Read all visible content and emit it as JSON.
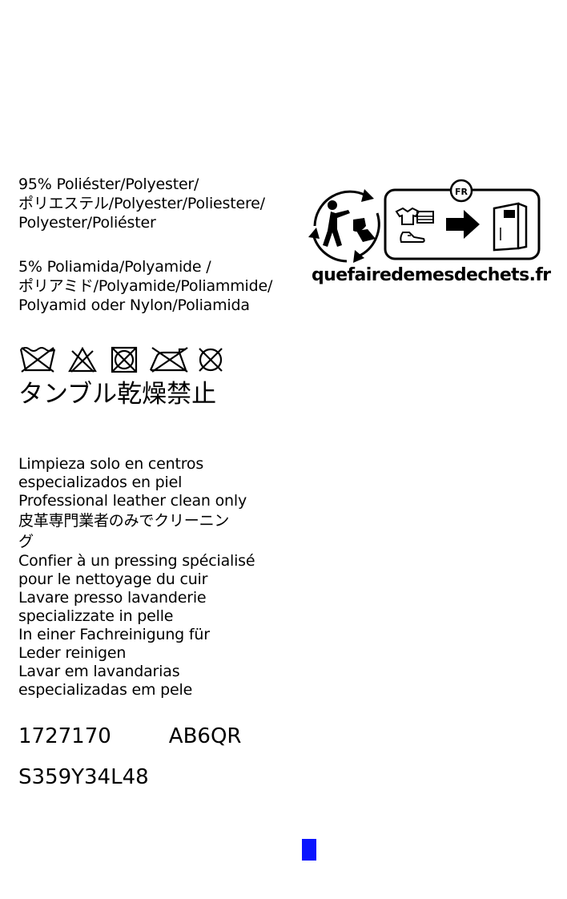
{
  "composition": {
    "main_fabric": [
      "95% Poliéster/Polyester/",
      "ポリエステル/Polyester/Poliestere/",
      "Polyester/Poliéster"
    ],
    "secondary_fabric": [
      "5% Poliamida/Polyamide /",
      "ポリアミド/Polyamide/Poliammide/",
      "Polyamid oder Nylon/Poliamida"
    ]
  },
  "care": {
    "symbols": [
      {
        "icon": "do-not-wash-icon"
      },
      {
        "icon": "do-not-bleach-icon"
      },
      {
        "icon": "do-not-tumble-dry-icon"
      },
      {
        "icon": "do-not-iron-icon"
      },
      {
        "icon": "do-not-dry-clean-icon"
      }
    ],
    "jp_no_tumble": "タンブル乾燥禁止",
    "instructions": [
      "Limpieza solo en centros",
      "especializados en piel",
      "Professional leather clean only",
      "皮革専門業者のみでクリーニン",
      "グ",
      "Confier à un pressing spécialisé",
      "pour le nettoyage du cuir",
      "Lavare presso lavanderie",
      "specializzate in pelle",
      "In einer Fachreinigung für",
      "Leder reinigen",
      "Lavar em lavandarias",
      "especializadas em pele"
    ]
  },
  "codes": {
    "article": "1727170",
    "lot": "AB6QR",
    "reference": "S359Y34L48"
  },
  "recycling": {
    "badge": "FR",
    "caption": "quefairedemesdechets.fr",
    "icons": [
      "triman-icon",
      "tshirt-icon",
      "folded-textile-icon",
      "shoe-icon",
      "arrow-right-icon",
      "collection-bin-icon"
    ]
  },
  "colors": {
    "text": "#000000",
    "marker": "#0a14ff"
  }
}
